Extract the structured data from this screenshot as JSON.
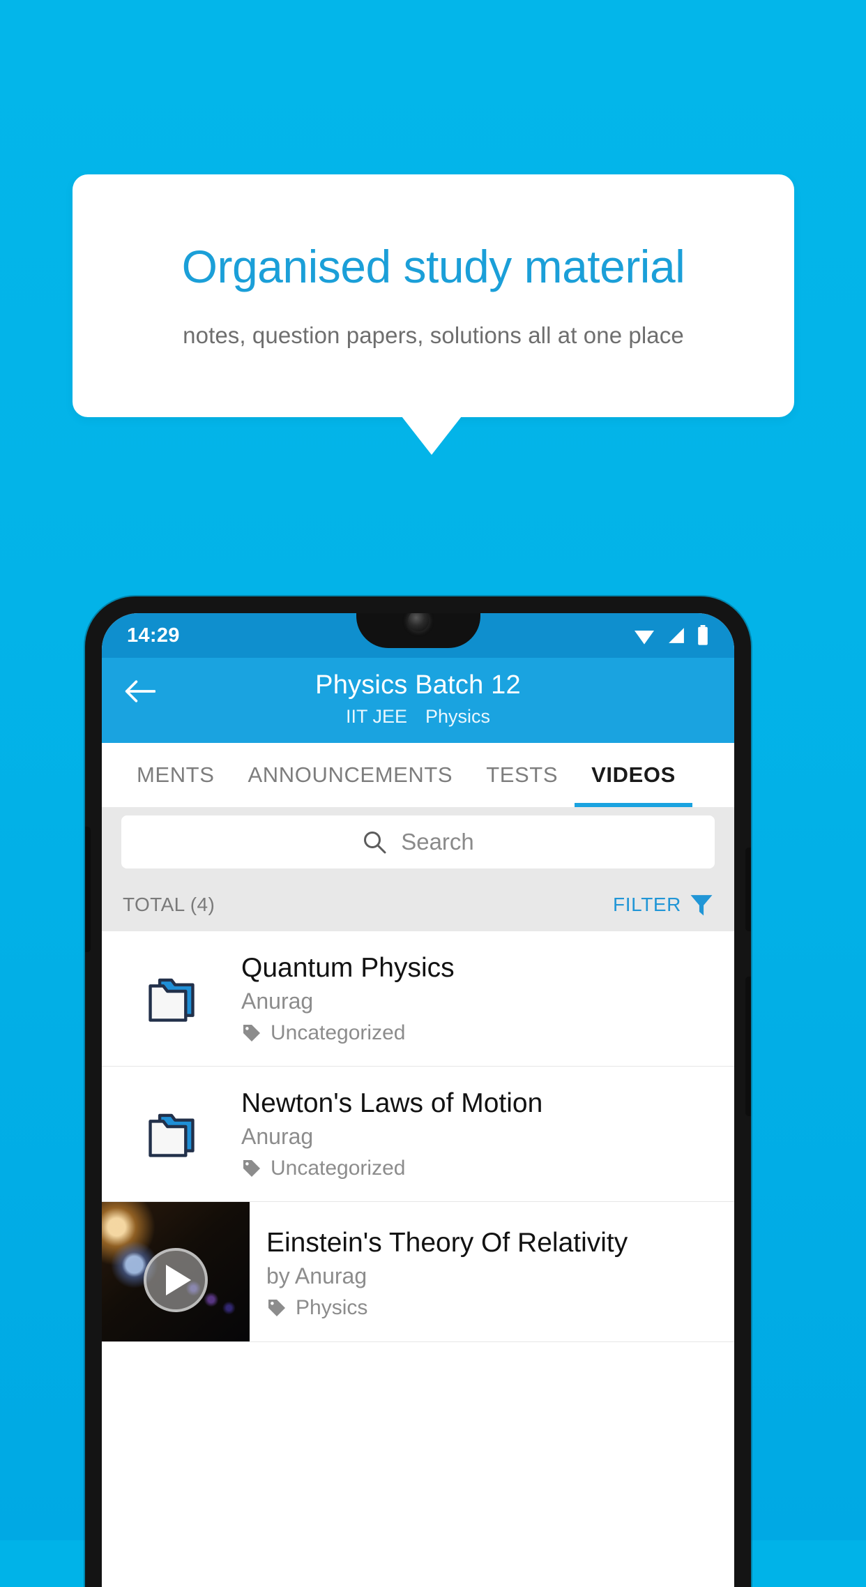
{
  "promo": {
    "title": "Organised study material",
    "subtitle": "notes, question papers, solutions all at one place",
    "title_color": "#1b9fd8",
    "background_color": "#03b3e8",
    "card_color": "#ffffff"
  },
  "phone": {
    "status_bar": {
      "time": "14:29",
      "icons": [
        "wifi-icon",
        "signal-icon",
        "battery-icon"
      ],
      "background_color": "#0f8fce"
    },
    "app_bar": {
      "back_icon": "back-arrow-icon",
      "title": "Physics Batch 12",
      "subtitle_course": "IIT JEE",
      "subtitle_subject": "Physics",
      "background_color": "#1aa3e0"
    },
    "tabs": [
      {
        "label": "MENTS",
        "active": false
      },
      {
        "label": "ANNOUNCEMENTS",
        "active": false
      },
      {
        "label": "TESTS",
        "active": false
      },
      {
        "label": "VIDEOS",
        "active": true
      }
    ],
    "search": {
      "icon": "search-icon",
      "placeholder": "Search",
      "value": ""
    },
    "meta_row": {
      "total_label": "TOTAL (4)",
      "filter_label": "FILTER",
      "filter_icon": "filter-funnel-icon",
      "filter_color": "#2196d6"
    },
    "list_items": [
      {
        "type": "folder",
        "icon": "folder-icon",
        "title": "Quantum Physics",
        "author": "Anurag",
        "tag_icon": "tag-icon",
        "tag": "Uncategorized"
      },
      {
        "type": "folder",
        "icon": "folder-icon",
        "title": "Newton's Laws of Motion",
        "author": "Anurag",
        "tag_icon": "tag-icon",
        "tag": "Uncategorized"
      },
      {
        "type": "video",
        "icon": "video-thumbnail",
        "play_icon": "play-icon",
        "title": "Einstein's Theory Of Relativity",
        "author": "by Anurag",
        "tag_icon": "tag-icon",
        "tag": "Physics"
      }
    ]
  }
}
